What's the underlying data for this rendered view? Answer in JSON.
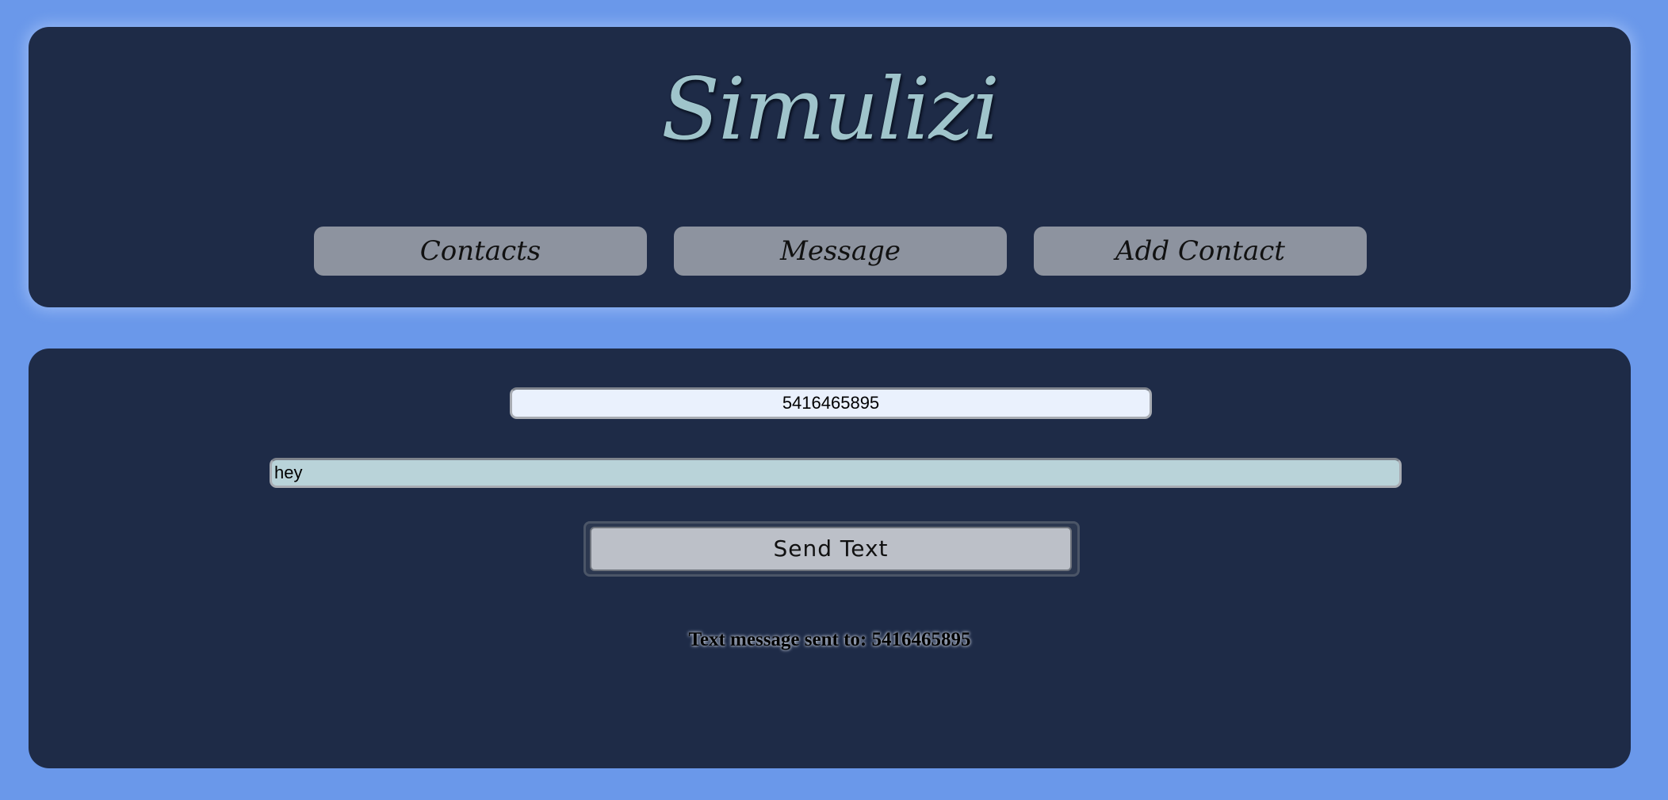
{
  "app": {
    "title": "Simulizi"
  },
  "nav": {
    "contacts_label": "Contacts",
    "message_label": "Message",
    "add_contact_label": "Add Contact"
  },
  "form": {
    "phone_value": "5416465895",
    "message_value": "hey",
    "send_label": "Send Text"
  },
  "status": {
    "text": "Text message sent to: 5416465895"
  },
  "colors": {
    "page_background": "#6a98ea",
    "panel_background": "#1e2b47",
    "title_color": "#9fc4cb",
    "nav_button_background": "#8d939f",
    "phone_input_background": "#eaf1fd",
    "message_input_background": "#b9d3d9",
    "send_button_background": "#bcc0c8"
  }
}
